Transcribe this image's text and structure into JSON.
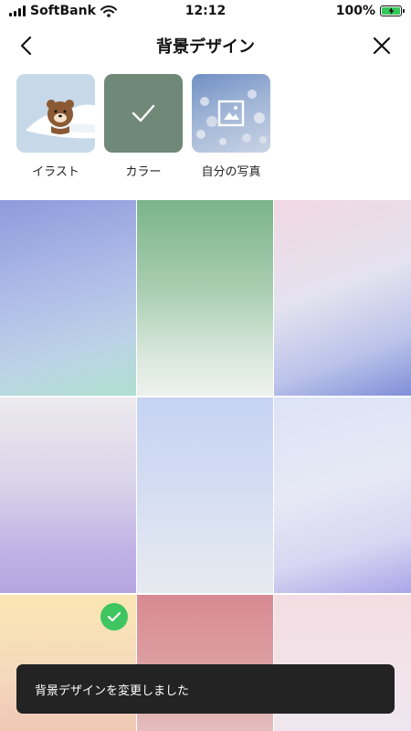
{
  "status_bar": {
    "carrier": "SoftBank",
    "time": "12:12",
    "battery_percent": "100%",
    "battery_level": 1.0,
    "battery_color": "#34c759"
  },
  "header": {
    "title": "背景デザイン",
    "back_icon": "chevron-left-icon",
    "close_icon": "close-icon"
  },
  "tabs": [
    {
      "label": "イラスト",
      "icon": "bear-illustration"
    },
    {
      "label": "カラー",
      "icon": "checkmark-icon",
      "selected": true
    },
    {
      "label": "自分の写真",
      "icon": "image-icon"
    }
  ],
  "swatches": [
    {
      "id": "gradient-blue-mint",
      "colors": [
        "#8e9bdc",
        "#aee0cf"
      ]
    },
    {
      "id": "gradient-green",
      "colors": [
        "#7bb48a",
        "#eef1ee"
      ]
    },
    {
      "id": "gradient-pink-blue",
      "colors": [
        "#f1d8e3",
        "#7f8fd8"
      ]
    },
    {
      "id": "gradient-grey-lavender",
      "colors": [
        "#ecebee",
        "#b6a6e0"
      ]
    },
    {
      "id": "gradient-pale-blue",
      "colors": [
        "#c6d3f3",
        "#e6e9ef"
      ]
    },
    {
      "id": "gradient-white-violet",
      "colors": [
        "#dce3f6",
        "#aaa6e8"
      ]
    },
    {
      "id": "gradient-yellow-peach",
      "colors": [
        "#f9e6b4",
        "#efc7b5"
      ],
      "selected": true
    },
    {
      "id": "gradient-rose",
      "colors": [
        "#d98a92",
        "#e5bcbc"
      ]
    },
    {
      "id": "gradient-pale-pink",
      "colors": [
        "#f3dde3",
        "#efe6ee"
      ]
    }
  ],
  "toast": {
    "text": "背景デザインを変更しました"
  },
  "colors": {
    "accent_check": "#3fc560",
    "toast_bg": "#232323"
  }
}
